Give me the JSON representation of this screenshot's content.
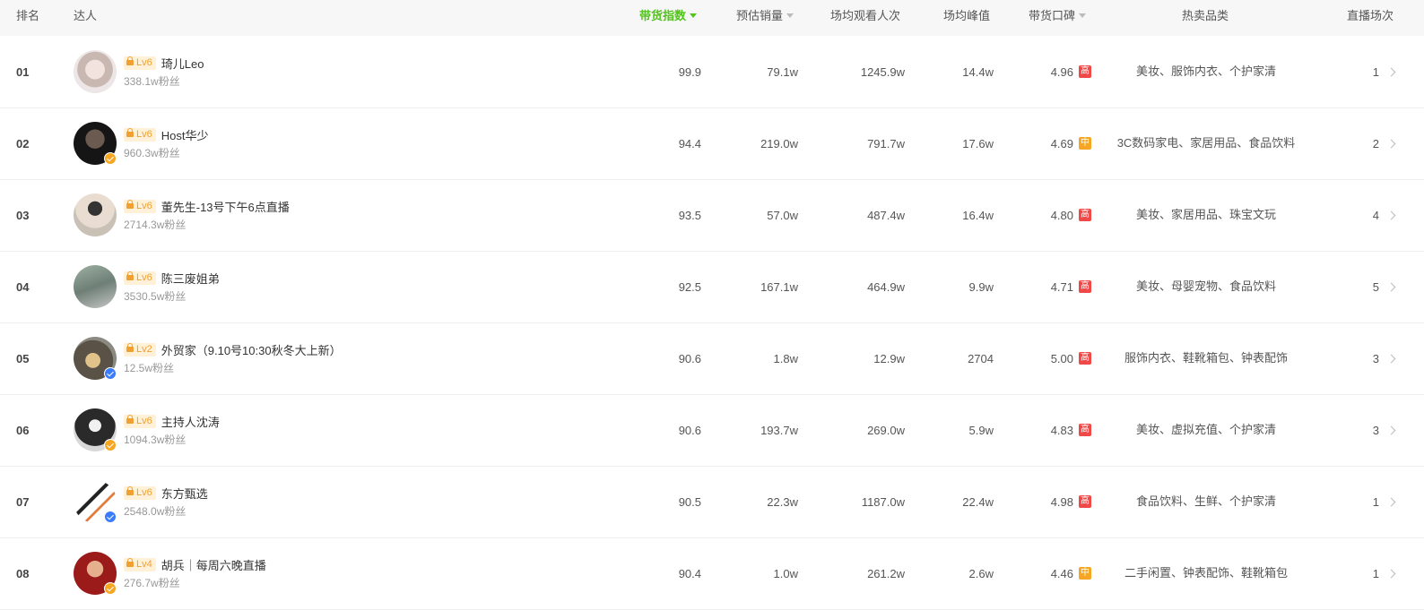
{
  "headers": {
    "rank": "排名",
    "influencer": "达人",
    "sales_index": "带货指数",
    "est_sales": "预估销量",
    "avg_views": "场均观看人次",
    "avg_peak": "场均峰值",
    "reputation": "带货口碑",
    "hot_categories": "热卖品类",
    "live_count": "直播场次"
  },
  "colors": {
    "accent": "#52c41a",
    "high": "#f04848",
    "mid": "#f5a623",
    "level_badge": "#f0a030"
  },
  "rows": [
    {
      "rank": "01",
      "level": "Lv6",
      "name": "琦儿Leo",
      "fans": "338.1w粉丝",
      "verified": "none",
      "index": "99.9",
      "sales": "79.1w",
      "views": "1245.9w",
      "peak": "14.4w",
      "score": "4.96",
      "score_tag": "高",
      "tag_type": "high",
      "categories": "美妆、服饰内衣、个护家清",
      "lives": "1"
    },
    {
      "rank": "02",
      "level": "Lv6",
      "name": "Host华少",
      "fans": "960.3w粉丝",
      "verified": "gold",
      "index": "94.4",
      "sales": "219.0w",
      "views": "791.7w",
      "peak": "17.6w",
      "score": "4.69",
      "score_tag": "中",
      "tag_type": "mid",
      "categories": "3C数码家电、家居用品、食品饮料",
      "lives": "2"
    },
    {
      "rank": "03",
      "level": "Lv6",
      "name": "董先生-13号下午6点直播",
      "fans": "2714.3w粉丝",
      "verified": "none",
      "index": "93.5",
      "sales": "57.0w",
      "views": "487.4w",
      "peak": "16.4w",
      "score": "4.80",
      "score_tag": "高",
      "tag_type": "high",
      "categories": "美妆、家居用品、珠宝文玩",
      "lives": "4"
    },
    {
      "rank": "04",
      "level": "Lv6",
      "name": "陈三废姐弟",
      "fans": "3530.5w粉丝",
      "verified": "none",
      "index": "92.5",
      "sales": "167.1w",
      "views": "464.9w",
      "peak": "9.9w",
      "score": "4.71",
      "score_tag": "高",
      "tag_type": "high",
      "categories": "美妆、母婴宠物、食品饮料",
      "lives": "5"
    },
    {
      "rank": "05",
      "level": "Lv2",
      "name": "外贸家（9.10号10:30秋冬大上新）",
      "fans": "12.5w粉丝",
      "verified": "blue",
      "index": "90.6",
      "sales": "1.8w",
      "views": "12.9w",
      "peak": "2704",
      "score": "5.00",
      "score_tag": "高",
      "tag_type": "high",
      "categories": "服饰内衣、鞋靴箱包、钟表配饰",
      "lives": "3"
    },
    {
      "rank": "06",
      "level": "Lv6",
      "name": "主持人沈涛",
      "fans": "1094.3w粉丝",
      "verified": "gold",
      "index": "90.6",
      "sales": "193.7w",
      "views": "269.0w",
      "peak": "5.9w",
      "score": "4.83",
      "score_tag": "高",
      "tag_type": "high",
      "categories": "美妆、虚拟充值、个护家清",
      "lives": "3"
    },
    {
      "rank": "07",
      "level": "Lv6",
      "name": "东方甄选",
      "fans": "2548.0w粉丝",
      "verified": "blue",
      "index": "90.5",
      "sales": "22.3w",
      "views": "1187.0w",
      "peak": "22.4w",
      "score": "4.98",
      "score_tag": "高",
      "tag_type": "high",
      "categories": "食品饮料、生鲜、个护家清",
      "lives": "1"
    },
    {
      "rank": "08",
      "level": "Lv4",
      "name": "胡兵｜每周六晚直播",
      "fans": "276.7w粉丝",
      "verified": "gold",
      "index": "90.4",
      "sales": "1.0w",
      "views": "261.2w",
      "peak": "2.6w",
      "score": "4.46",
      "score_tag": "中",
      "tag_type": "mid",
      "categories": "二手闲置、钟表配饰、鞋靴箱包",
      "lives": "1"
    }
  ]
}
